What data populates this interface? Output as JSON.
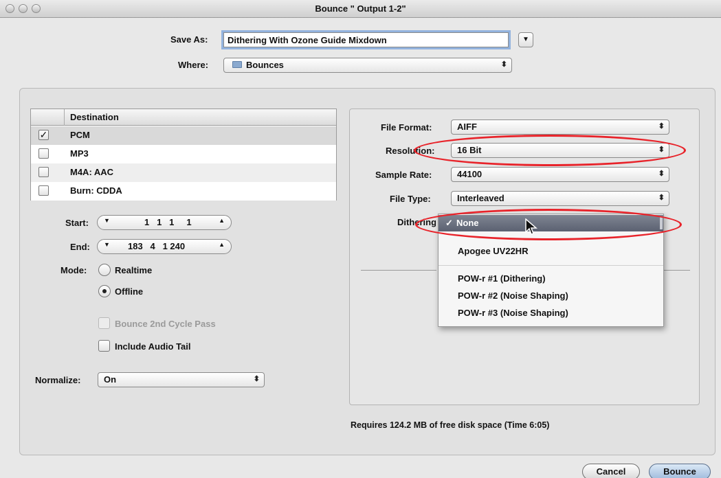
{
  "window": {
    "title": "Bounce \" Output 1-2\""
  },
  "save_as": {
    "label": "Save As:",
    "value": "Dithering With Ozone Guide Mixdown"
  },
  "where": {
    "label": "Where:",
    "value": "Bounces"
  },
  "destination": {
    "header": "Destination",
    "rows": [
      {
        "name": "PCM",
        "checked": true
      },
      {
        "name": "MP3",
        "checked": false
      },
      {
        "name": "M4A: AAC",
        "checked": false
      },
      {
        "name": "Burn: CDDA",
        "checked": false
      }
    ]
  },
  "start": {
    "label": "Start:",
    "value": "1   1   1     1"
  },
  "end": {
    "label": "End:",
    "value": "183   4   1 240"
  },
  "mode": {
    "label": "Mode:",
    "options": [
      "Realtime",
      "Offline"
    ],
    "selected": "Offline"
  },
  "bounce_2nd_cycle": {
    "label": "Bounce 2nd Cycle Pass",
    "enabled": false
  },
  "include_audio_tail": {
    "label": "Include Audio Tail",
    "checked": false
  },
  "normalize": {
    "label": "Normalize:",
    "value": "On"
  },
  "file_format": {
    "label": "File Format:",
    "value": "AIFF"
  },
  "resolution": {
    "label": "Resolution:",
    "value": "16 Bit"
  },
  "sample_rate": {
    "label": "Sample Rate:",
    "value": "44100"
  },
  "file_type": {
    "label": "File Type:",
    "value": "Interleaved"
  },
  "dithering": {
    "label": "Dithering",
    "options": [
      "None",
      "Apogee UV22HR",
      "POW-r #1 (Dithering)",
      "POW-r #2 (Noise Shaping)",
      "POW-r #3 (Noise Shaping)"
    ],
    "selected": "None",
    "check_glyph": "✓"
  },
  "disk_space": "Requires 124.2 MB of free disk space  (Time 6:05)",
  "buttons": {
    "cancel": "Cancel",
    "bounce": "Bounce"
  },
  "highlight_color": "#e8232a"
}
